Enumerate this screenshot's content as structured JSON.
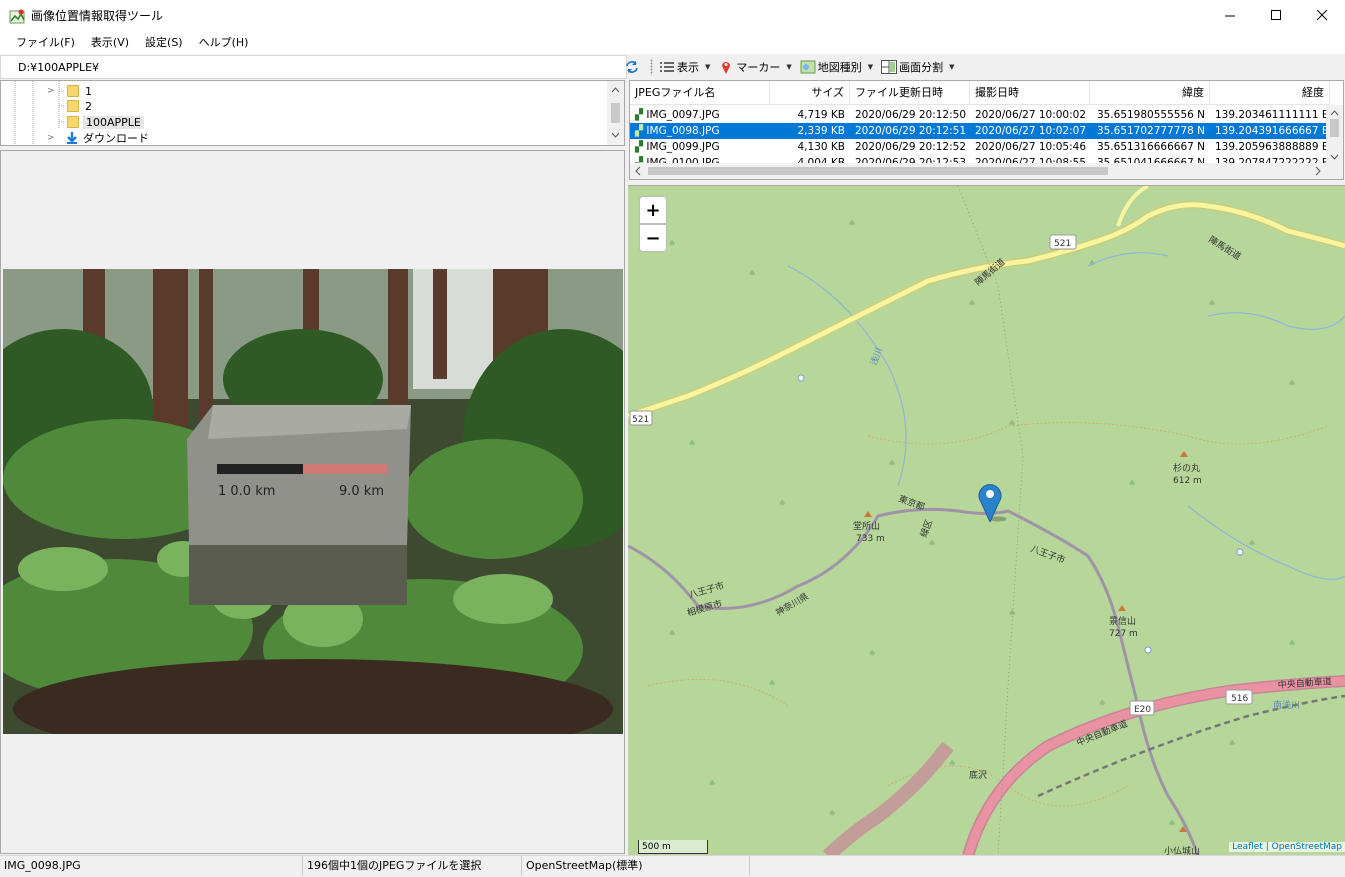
{
  "window": {
    "title": "画像位置情報取得ツール"
  },
  "menu": [
    {
      "label": "ファイル(F)"
    },
    {
      "label": "表示(V)"
    },
    {
      "label": "設定(S)"
    },
    {
      "label": "ヘルプ(H)"
    }
  ],
  "path": {
    "value": "D:¥100APPLE¥"
  },
  "toolbar": {
    "view": "表示",
    "marker": "マーカー",
    "map_type": "地図種別",
    "split": "画面分割"
  },
  "tree": [
    {
      "label": "1"
    },
    {
      "label": "2"
    },
    {
      "label": "100APPLE"
    },
    {
      "label": "ダウンロード"
    }
  ],
  "filelist": {
    "columns": [
      "JPEGファイル名",
      "サイズ",
      "ファイル更新日時",
      "撮影日時",
      "緯度",
      "経度"
    ],
    "rows": [
      [
        "IMG_0097.JPG",
        "4,719 KB",
        "2020/06/29 20:12:50",
        "2020/06/27 10:00:02",
        "35.651980555556 N",
        "139.203461111111 E"
      ],
      [
        "IMG_0098.JPG",
        "2,339 KB",
        "2020/06/29 20:12:51",
        "2020/06/27 10:02:07",
        "35.651702777778 N",
        "139.204391666667 E"
      ],
      [
        "IMG_0099.JPG",
        "4,130 KB",
        "2020/06/29 20:12:52",
        "2020/06/27 10:05:46",
        "35.651316666667 N",
        "139.205963888889 E"
      ],
      [
        "IMG_0100.JPG",
        "4,004 KB",
        "2020/06/29 20:12:53",
        "2020/06/27 10:08:55",
        "35.651041666667 N",
        "139.207847222222 E"
      ]
    ]
  },
  "map": {
    "labels": [
      "521",
      "521",
      "陣馬街道",
      "陣馬街道",
      "浅川",
      "東京都",
      "八王子市",
      "相模原市",
      "神奈川県",
      "緑区",
      "八王子市",
      "杉の丸",
      "612 m",
      "堂所山",
      "733 m",
      "景信山",
      "727 m",
      "中央自動車道",
      "中央自動車道",
      "E20",
      "516",
      "底沢",
      "南浅川",
      "小仏城山"
    ],
    "scale": "500 m",
    "attribution": "Leaflet | OpenStreetMap"
  },
  "status": {
    "file": "IMG_0098.JPG",
    "selection": "196個中1個のJPEGファイルを選択",
    "map": "OpenStreetMap(標準)"
  },
  "colors": {
    "selection": "#0078d7",
    "map_bg": "#b6d69a",
    "road_yellow": "#f7f5a0",
    "highway": "#e892a2",
    "boundary": "#a093a8"
  }
}
